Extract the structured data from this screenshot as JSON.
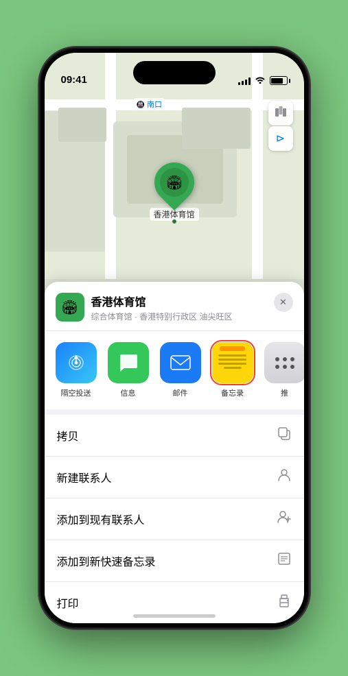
{
  "status_bar": {
    "time": "09:41",
    "location_arrow": "▲"
  },
  "map": {
    "label": "南口",
    "label_prefix": "地铁"
  },
  "location_pin": {
    "label": "香港体育馆",
    "icon": "🏟"
  },
  "controls": {
    "map_type": "🗺",
    "location": "➤"
  },
  "venue_header": {
    "name": "香港体育馆",
    "subtitle": "综合体育馆 · 香港特别行政区 油尖旺区",
    "close": "✕"
  },
  "share_items": [
    {
      "id": "airdrop",
      "label": "隔空投送",
      "type": "airdrop"
    },
    {
      "id": "message",
      "label": "信息",
      "type": "message"
    },
    {
      "id": "mail",
      "label": "邮件",
      "type": "mail"
    },
    {
      "id": "notes",
      "label": "备忘录",
      "type": "notes",
      "selected": true
    },
    {
      "id": "more",
      "label": "推",
      "type": "more"
    }
  ],
  "action_items": [
    {
      "id": "copy",
      "label": "拷贝",
      "icon": "copy"
    },
    {
      "id": "new-contact",
      "label": "新建联系人",
      "icon": "person"
    },
    {
      "id": "add-contact",
      "label": "添加到现有联系人",
      "icon": "person-add"
    },
    {
      "id": "quick-note",
      "label": "添加到新快速备忘录",
      "icon": "note"
    },
    {
      "id": "print",
      "label": "打印",
      "icon": "print"
    }
  ]
}
